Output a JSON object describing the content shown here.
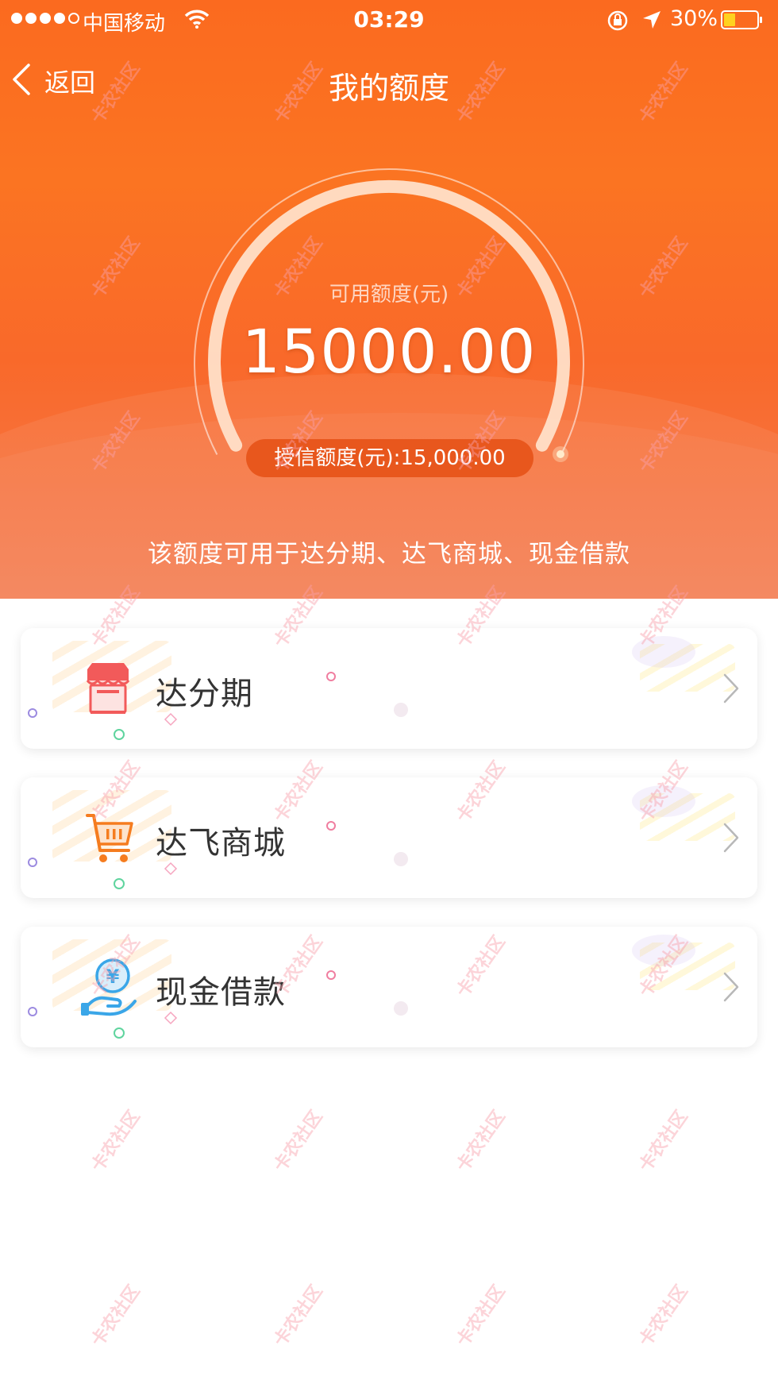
{
  "status_bar": {
    "carrier": "中国移动",
    "time": "03:29",
    "battery": "30%"
  },
  "nav": {
    "back_label": "返回",
    "title": "我的额度"
  },
  "gauge": {
    "label": "可用额度(元)",
    "value": "15000.00",
    "credit_limit": "授信额度(元):15,000.00",
    "usage_fraction": 1.0
  },
  "usage_note": "该额度可用于达分期、达飞商城、现金借款",
  "items": [
    {
      "label": "达分期",
      "icon": "shop-icon"
    },
    {
      "label": "达飞商城",
      "icon": "cart-icon"
    },
    {
      "label": "现金借款",
      "icon": "hand-coin-icon"
    }
  ],
  "watermark": "卡农社区",
  "colors": {
    "accent": "#fb6a1f",
    "pill": "#e8571d",
    "shop_icon": "#f25a5a",
    "cart_icon": "#f57c1f",
    "coin_icon": "#3aa6e8"
  }
}
